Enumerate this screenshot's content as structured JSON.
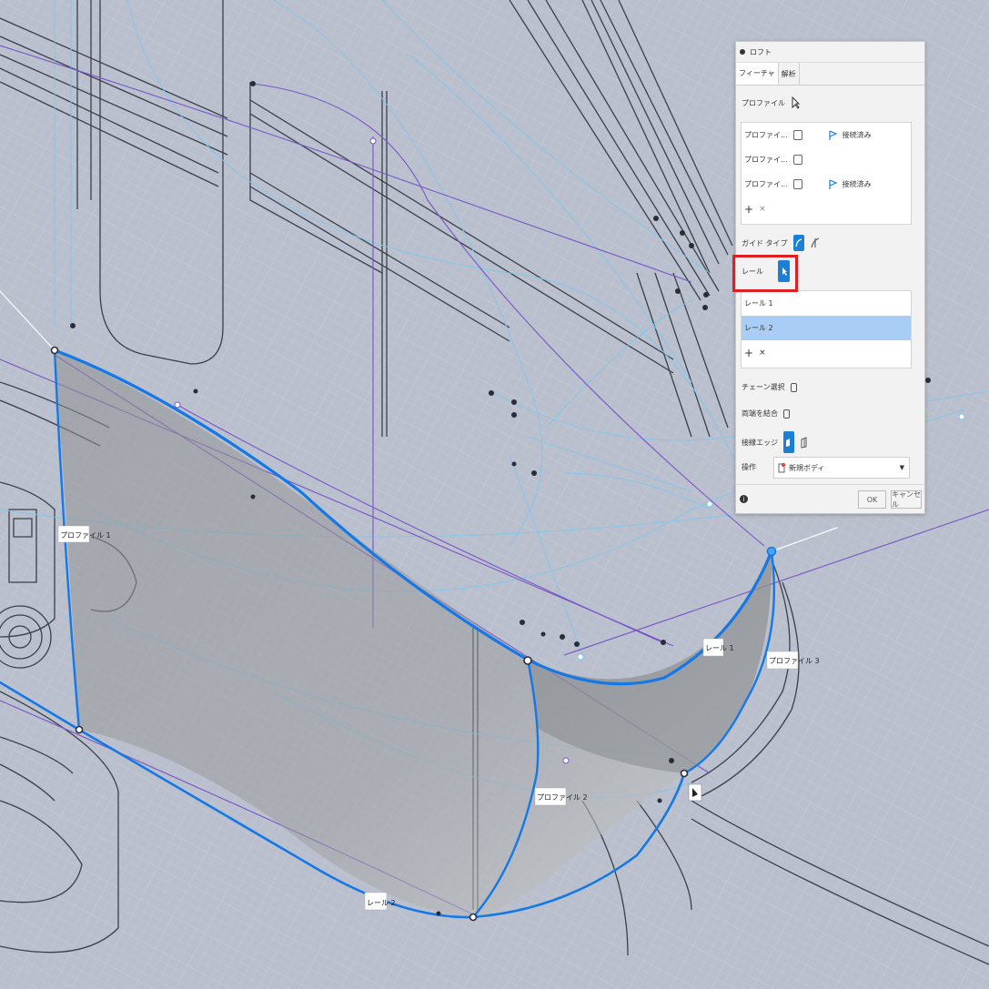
{
  "dialog": {
    "title": "ロフト",
    "tabs": [
      {
        "label": "フィーチャ"
      },
      {
        "label": "解析"
      }
    ],
    "profiles_label": "プロファイル",
    "profiles": [
      {
        "name": "プロファイ...",
        "status": "接続済み"
      },
      {
        "name": "プロファイ...",
        "status": ""
      },
      {
        "name": "プロファイ...",
        "status": "接続済み"
      }
    ],
    "guide_type_label": "ガイド タイプ",
    "rails_label": "レール",
    "rails": [
      {
        "name": "レール 1",
        "selected": false
      },
      {
        "name": "レール 2",
        "selected": true
      }
    ],
    "chain_selection_label": "チェーン選択",
    "closed_label": "両端を結合",
    "tangent_edges_label": "接線エッジ",
    "operation_label": "操作",
    "operation_value": "新規ボディ",
    "ok_label": "OK",
    "cancel_label": "キャンセル",
    "info_icon": "info-icon"
  },
  "viewport": {
    "labels": {
      "profile1": "プロファイル 1",
      "profile2": "プロファイル 2",
      "profile3": "プロファイル 3",
      "rail1": "レール 1",
      "rail2": "レール 2"
    }
  },
  "colors": {
    "accent": "#1b7fd6",
    "curve": "#1478e6",
    "highlight": "#e02020"
  }
}
